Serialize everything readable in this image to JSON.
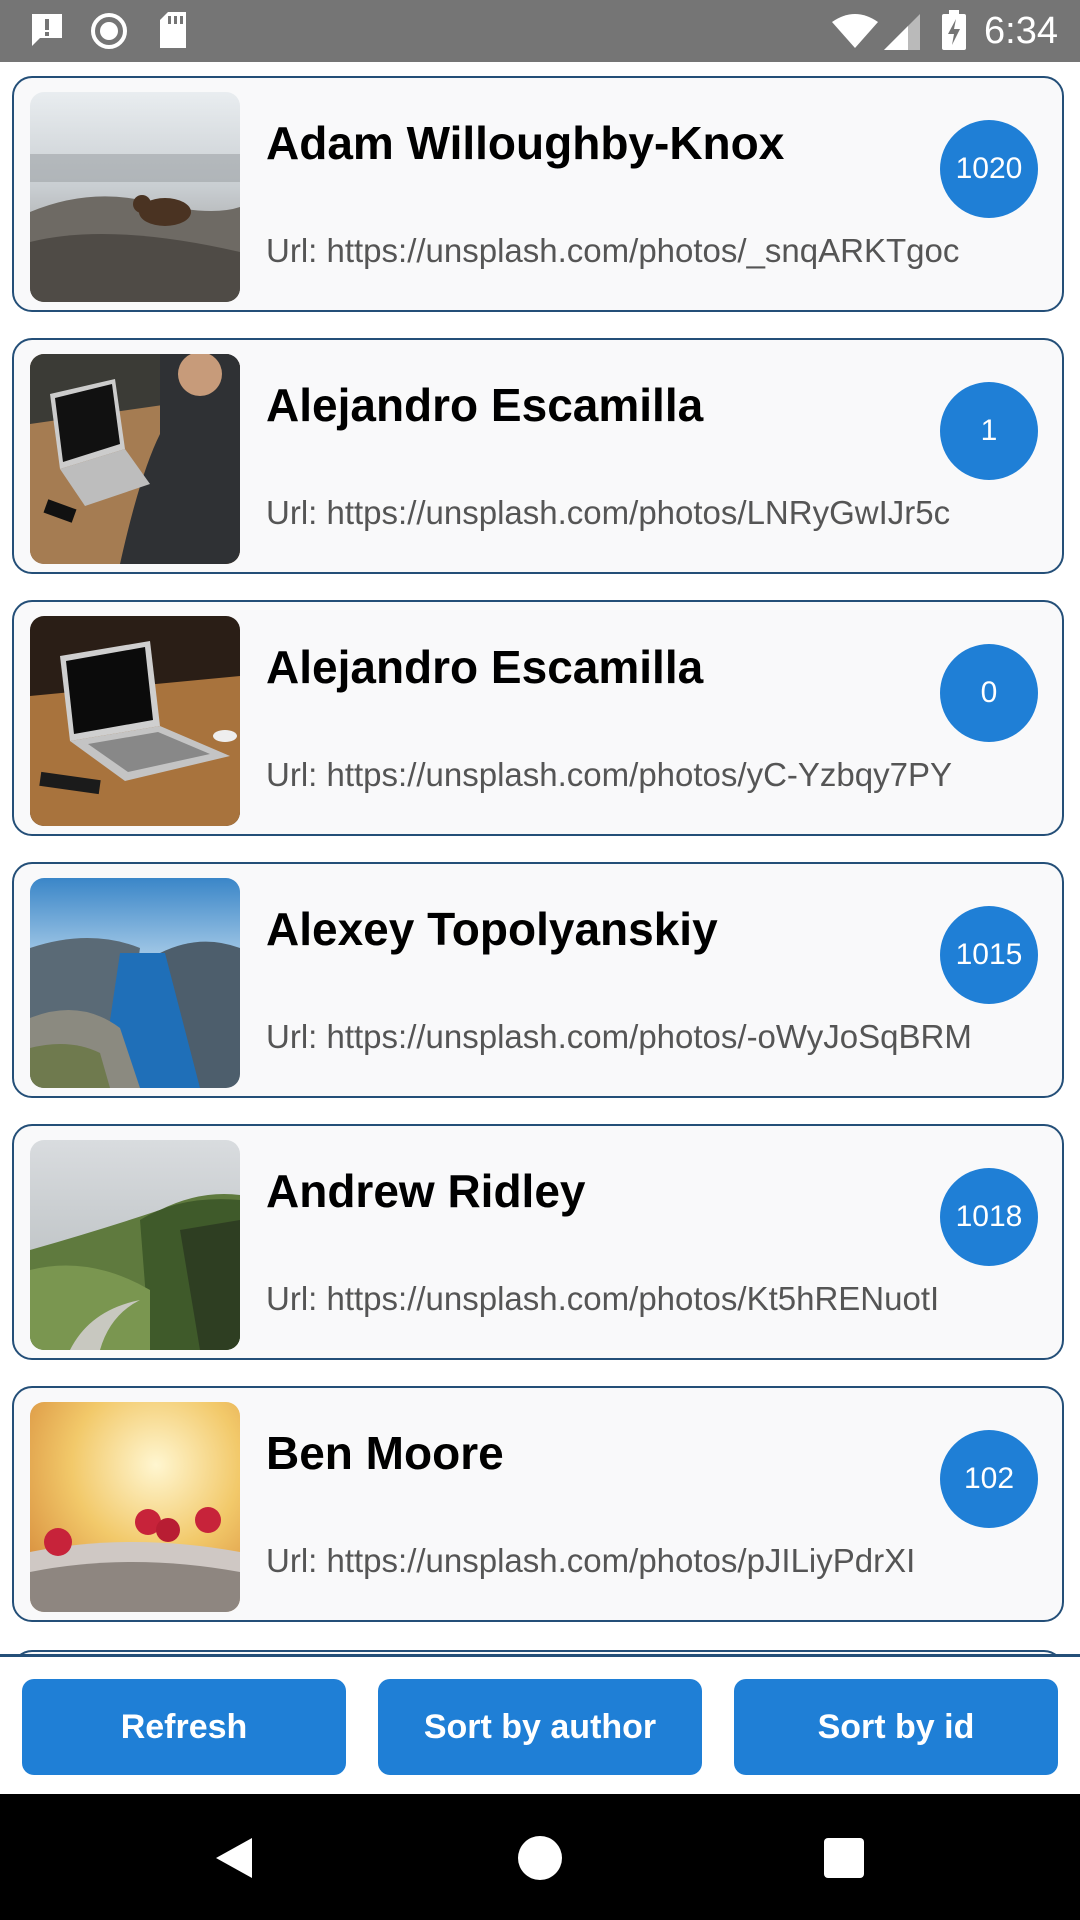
{
  "status_bar": {
    "time": "6:34",
    "icons": [
      "alert-icon",
      "circle-icon",
      "sd-card-icon",
      "wifi-icon",
      "signal-icon",
      "battery-charging-icon"
    ]
  },
  "photos": [
    {
      "author": "Adam Willoughby-Knox",
      "url": "Url: https://unsplash.com/photos/_snqARKTgoc",
      "id": "1020",
      "thumb": "bear-on-rocks"
    },
    {
      "author": "Alejandro Escamilla",
      "url": "Url: https://unsplash.com/photos/LNRyGwIJr5c",
      "id": "1",
      "thumb": "person-typing-laptop"
    },
    {
      "author": "Alejandro Escamilla",
      "url": "Url: https://unsplash.com/photos/yC-Yzbqy7PY",
      "id": "0",
      "thumb": "laptop-on-desk"
    },
    {
      "author": "Alexey Topolyanskiy",
      "url": "Url: https://unsplash.com/photos/-oWyJoSqBRM",
      "id": "1015",
      "thumb": "fjord-river"
    },
    {
      "author": "Andrew Ridley",
      "url": "Url: https://unsplash.com/photos/Kt5hRENuotI",
      "id": "1018",
      "thumb": "green-mountains"
    },
    {
      "author": "Ben Moore",
      "url": "Url: https://unsplash.com/photos/pJILiyPdrXI",
      "id": "102",
      "thumb": "raspberries"
    }
  ],
  "buttons": {
    "refresh": "Refresh",
    "sort_author": "Sort by author",
    "sort_id": "Sort by id"
  },
  "colors": {
    "accent": "#1f7fd6",
    "card_border": "#244f78",
    "status_bar": "#757575"
  }
}
